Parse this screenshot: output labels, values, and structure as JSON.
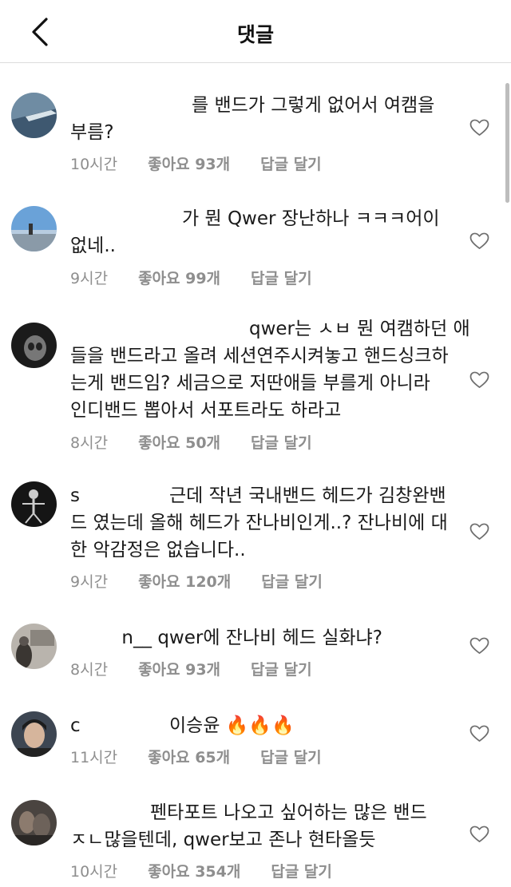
{
  "header": {
    "title": "댓글"
  },
  "comments": [
    {
      "user": "",
      "lines": [
        "를 밴드가 그렇게 없어서 여캠을",
        "부름?"
      ],
      "time": "10시간",
      "likes": "좋아요 93개",
      "reply": "답글 달기"
    },
    {
      "user": "",
      "lines": [
        "가 뭔 Qwer 장난하나 ㅋㅋㅋ어이",
        "없네.."
      ],
      "time": "9시간",
      "likes": "좋아요 99개",
      "reply": "답글 달기"
    },
    {
      "user": "",
      "lines": [
        "qwer는 ㅅㅂ 뭔 여캠하던 애",
        "들을 밴드라고 올려 세션연주시켜놓고 핸드싱크하",
        "는게 밴드임? 세금으로 저딴애들 부를게 아니라",
        "인디밴드 뽑아서 서포트라도 하라고"
      ],
      "time": "8시간",
      "likes": "좋아요 50개",
      "reply": "답글 달기"
    },
    {
      "user": "s",
      "lines": [
        "근데 작년 국내밴드 헤드가 김창완밴",
        "드 였는데 올해 헤드가 잔나비인게..? 잔나비에 대",
        "한 악감정은 없습니다.."
      ],
      "time": "9시간",
      "likes": "좋아요 120개",
      "reply": "답글 달기"
    },
    {
      "user": "n__",
      "lines": [
        "qwer에 잔나비 헤드 실화냐?"
      ],
      "time": "8시간",
      "likes": "좋아요 93개",
      "reply": "답글 달기"
    },
    {
      "user": "c",
      "lines": [
        "이승윤 🔥🔥🔥"
      ],
      "time": "11시간",
      "likes": "좋아요 65개",
      "reply": "답글 달기"
    },
    {
      "user": "",
      "lines": [
        "펜타포트 나오고 싶어하는 많은 밴드",
        "ㅈㄴ많을텐데, qwer보고 존나 현타올듯"
      ],
      "time": "10시간",
      "likes": "좋아요 354개",
      "reply": "답글 달기"
    }
  ]
}
